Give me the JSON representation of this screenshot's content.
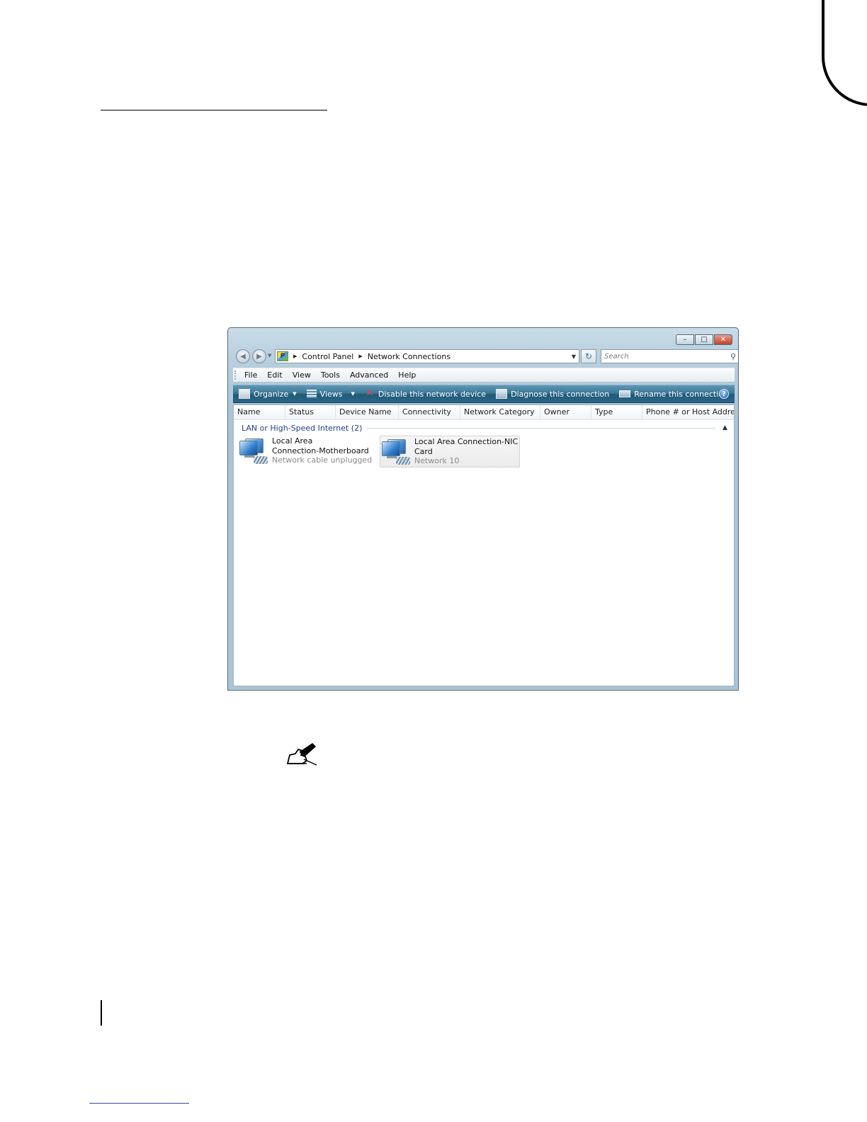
{
  "window": {
    "title_buttons": {
      "minimize": "–",
      "maximize": "□",
      "close": "✕"
    }
  },
  "nav": {
    "back": "◀",
    "forward": "▶",
    "breadcrumb": [
      "Control Panel",
      "Network Connections"
    ],
    "search_placeholder": "Search"
  },
  "menu": [
    "File",
    "Edit",
    "View",
    "Tools",
    "Advanced",
    "Help"
  ],
  "commands": {
    "organize": "Organize",
    "views": "Views",
    "disable": "Disable this network device",
    "diagnose": "Diagnose this connection",
    "rename": "Rename this connection",
    "more": "»",
    "help": "?"
  },
  "columns": [
    "Name",
    "Status",
    "Device Name",
    "Connectivity",
    "Network Category",
    "Owner",
    "Type",
    "Phone # or Host Addre..."
  ],
  "group": {
    "label": "LAN or High-Speed Internet (2)"
  },
  "connections": [
    {
      "name_line1": "Local Area",
      "name_line2": "Connection-Motherboard",
      "status": "Network cable unplugged"
    },
    {
      "name_line1": "Local Area Connection-NIC",
      "name_line2": "Card",
      "status": "Network 10"
    }
  ],
  "icons": {
    "address": "control-panel-icon",
    "refresh": "refresh-icon",
    "search": "search-icon",
    "connection": "network-connection-icon",
    "note": "writing-hand-icon"
  },
  "colors": {
    "command_bar": "#2a6686",
    "group_label": "#1f3e8c",
    "status_text": "#8a8a8a"
  }
}
